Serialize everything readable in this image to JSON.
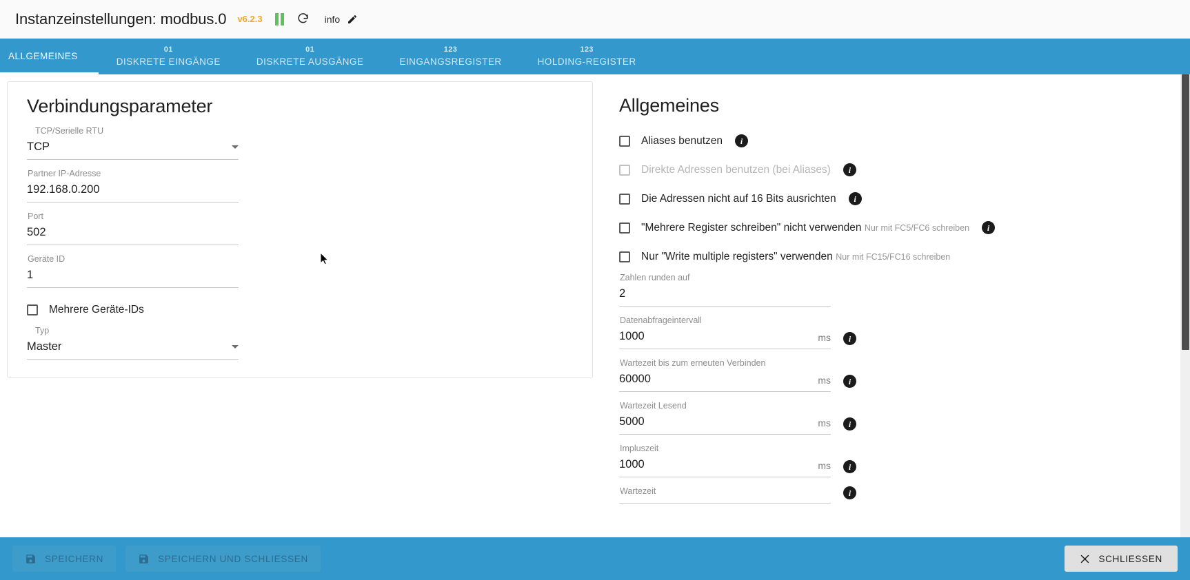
{
  "header": {
    "title": "Instanzeinstellungen: modbus.0",
    "version": "v6.2.3",
    "pause_icon": "pause-icon",
    "refresh_icon": "refresh-icon",
    "info_label": "info",
    "edit_icon": "pencil-icon"
  },
  "tabs": [
    {
      "sup": "",
      "label": "ALLGEMEINES",
      "active": true
    },
    {
      "sup": "01",
      "label": "DISKRETE EINGÄNGE",
      "active": false
    },
    {
      "sup": "01",
      "label": "DISKRETE AUSGÄNGE",
      "active": false
    },
    {
      "sup": "123",
      "label": "EINGANGSREGISTER",
      "active": false
    },
    {
      "sup": "123",
      "label": "HOLDING-REGISTER",
      "active": false
    }
  ],
  "connection": {
    "title": "Verbindungsparameter",
    "protocol": {
      "label": "TCP/Serielle RTU",
      "value": "TCP"
    },
    "ip": {
      "label": "Partner IP-Adresse",
      "value": "192.168.0.200"
    },
    "port": {
      "label": "Port",
      "value": "502"
    },
    "device_id": {
      "label": "Geräte ID",
      "value": "1"
    },
    "multi_device": {
      "label": "Mehrere Geräte-IDs",
      "checked": false
    },
    "type": {
      "label": "Typ",
      "value": "Master"
    }
  },
  "general": {
    "title": "Allgemeines",
    "checkboxes": [
      {
        "label": "Aliases benutzen",
        "sub": "",
        "checked": false,
        "disabled": false,
        "info": true
      },
      {
        "label": "Direkte Adressen benutzen (bei Aliases)",
        "sub": "",
        "checked": false,
        "disabled": true,
        "info": true
      },
      {
        "label": "Die Adressen nicht auf 16 Bits ausrichten",
        "sub": "",
        "checked": false,
        "disabled": false,
        "info": true
      },
      {
        "label": "\"Mehrere Register schreiben\" nicht verwenden",
        "sub": "Nur mit FC5/FC6 schreiben",
        "checked": false,
        "disabled": false,
        "info": true
      },
      {
        "label": "Nur \"Write multiple registers\" verwenden",
        "sub": "Nur mit FC15/FC16 schreiben",
        "checked": false,
        "disabled": false,
        "info": false
      }
    ],
    "fields": [
      {
        "label": "Zahlen runden auf",
        "value": "2",
        "unit": "",
        "info": false
      },
      {
        "label": "Datenabfrageintervall",
        "value": "1000",
        "unit": "ms",
        "info": true
      },
      {
        "label": "Wartezeit bis zum erneuten Verbinden",
        "value": "60000",
        "unit": "ms",
        "info": true
      },
      {
        "label": "Wartezeit Lesend",
        "value": "5000",
        "unit": "ms",
        "info": true
      },
      {
        "label": "Impluszeit",
        "value": "1000",
        "unit": "ms",
        "info": true
      },
      {
        "label": "Wartezeit",
        "value": "",
        "unit": "",
        "info": true
      }
    ]
  },
  "footer": {
    "save_label": "SPEICHERN",
    "save_close_label": "SPEICHERN UND SCHLIESSEN",
    "close_label": "SCHLIESSEN"
  },
  "colors": {
    "accent": "#3399cc",
    "version": "#f5a623",
    "pause": "#5ec15e"
  }
}
